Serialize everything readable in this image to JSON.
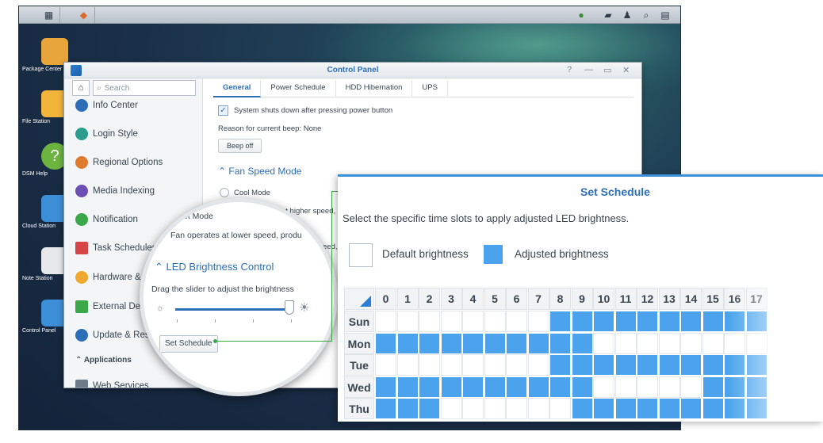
{
  "taskbar": {
    "icons": [
      "apps-grid-icon",
      "package-icon",
      "status-icon",
      "chat-icon",
      "user-icon",
      "search-icon",
      "widget-icon"
    ]
  },
  "desktop_icons": [
    {
      "label": "Package Center",
      "icon": "package-center-icon",
      "color": "#e8a53a"
    },
    {
      "label": "File Station",
      "icon": "folder-icon",
      "color": "#f2b53a"
    },
    {
      "label": "DSM Help",
      "icon": "help-icon",
      "color": "#6cb33f"
    },
    {
      "label": "Cloud Station",
      "icon": "cloud-icon",
      "color": "#3c8ed6"
    },
    {
      "label": "Note Station",
      "icon": "note-icon",
      "color": "#e6e8ea"
    },
    {
      "label": "Control Panel",
      "icon": "control-panel-icon",
      "color": "#3c8ed6"
    }
  ],
  "control_panel": {
    "title": "Control Panel",
    "window_controls": [
      "?",
      "—",
      "▭",
      "✕"
    ],
    "search_placeholder": "Search",
    "sidebar": [
      {
        "label": "Info Center",
        "color": "#2d6fb7"
      },
      {
        "label": "Login Style",
        "color": "#2a9d8f"
      },
      {
        "label": "Regional Options",
        "color": "#e07a2f"
      },
      {
        "label": "Media Indexing",
        "color": "#6c4fb3"
      },
      {
        "label": "Notification",
        "color": "#3aa84a"
      },
      {
        "label": "Task Scheduler",
        "color": "#d64545"
      },
      {
        "label": "Hardware & Power",
        "color": "#f0a830"
      },
      {
        "label": "External Devices",
        "color": "#3aa84a"
      },
      {
        "label": "Update & Restore",
        "color": "#2d6fb7"
      }
    ],
    "sidebar_section": "Applications",
    "sidebar_last": "Web Services",
    "tabs": [
      "General",
      "Power Schedule",
      "HDD Hibernation",
      "UPS"
    ],
    "active_tab": "General",
    "shutdown_label": "System shuts down after pressing power button",
    "beep_reason": "Reason for current beep: None",
    "beep_off": "Beep off",
    "fan_speed_heading": "Fan Speed Mode",
    "cool_mode": "Cool Mode",
    "higher_speed_fragment": "at higher speed,",
    "speed_fragment": "speed,"
  },
  "magnifier": {
    "mode_fragment": "et Mode",
    "fan_lower": "Fan operates at lower speed, produ",
    "led_heading": "LED Brightness Control",
    "slider_hint": "Drag the slider to adjust the brightness",
    "slider_value": 0.95,
    "set_schedule_button": "Set Schedule"
  },
  "schedule": {
    "title": "Set Schedule",
    "description": "Select the specific time slots to apply adjusted LED brightness.",
    "legend": [
      {
        "label": "Default brightness",
        "color": "#ffffff"
      },
      {
        "label": "Adjusted brightness",
        "color": "#4aa3ec"
      }
    ],
    "hours": [
      "0",
      "1",
      "2",
      "3",
      "4",
      "5",
      "6",
      "7",
      "8",
      "9",
      "10",
      "11",
      "12",
      "13",
      "14",
      "15",
      "16",
      "17"
    ],
    "days": [
      "Sun",
      "Mon",
      "Tue",
      "Wed",
      "Thu"
    ],
    "adjusted_slots": {
      "Sun": [
        8,
        9,
        10,
        11,
        12,
        13,
        14,
        15,
        16,
        17
      ],
      "Mon": [
        0,
        1,
        2,
        3,
        4,
        5,
        6,
        7,
        8,
        9
      ],
      "Tue": [
        8,
        9,
        10,
        11,
        12,
        13,
        14,
        15,
        16,
        17
      ],
      "Wed": [
        0,
        1,
        2,
        3,
        4,
        5,
        6,
        7,
        8,
        9,
        15,
        16,
        17
      ],
      "Thu": [
        0,
        1,
        2,
        9,
        10,
        11,
        12,
        13,
        14,
        15,
        16,
        17
      ]
    },
    "accent": "#2d6fb7"
  }
}
